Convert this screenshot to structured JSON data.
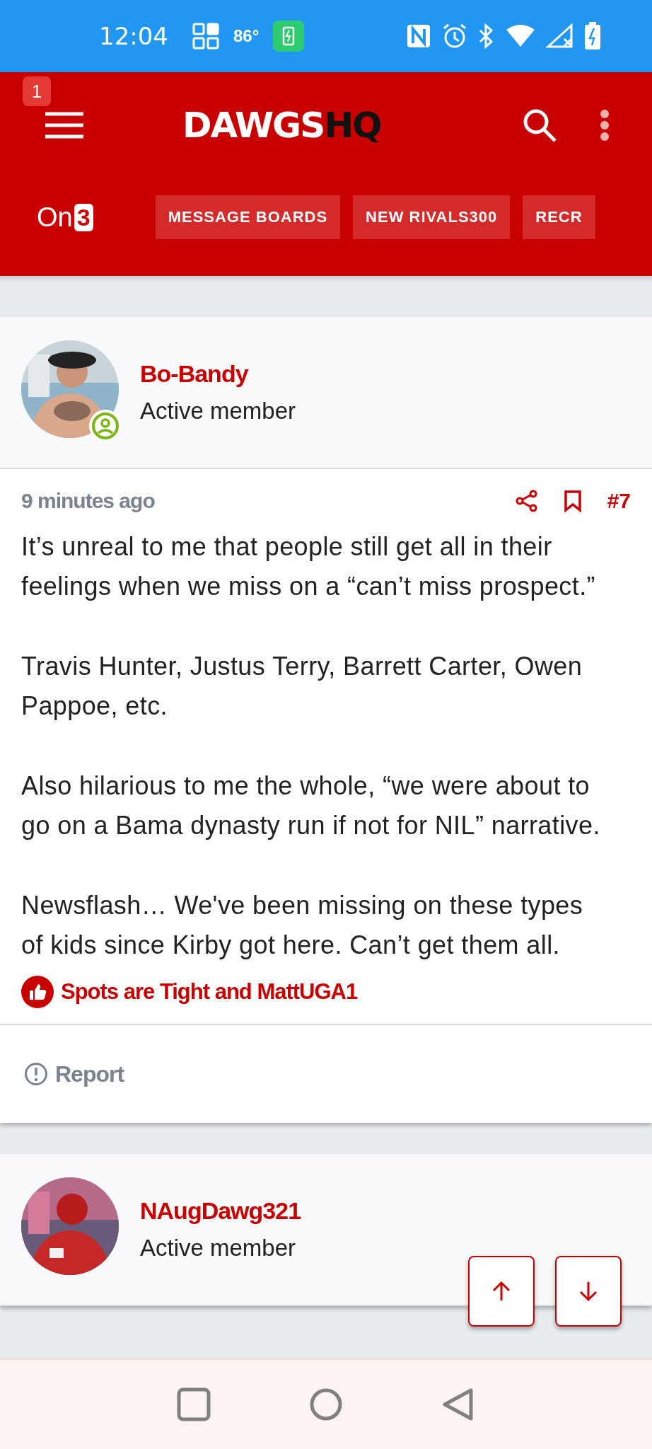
{
  "status_bar": {
    "time": "12:04",
    "temperature": "86°"
  },
  "header": {
    "notification_badge": "1",
    "logo": {
      "main": "DAWGS",
      "accent": "HQ"
    }
  },
  "nav": {
    "brand": {
      "text": "On",
      "digit": "3"
    },
    "links": [
      {
        "label": "MESSAGE BOARDS"
      },
      {
        "label": "NEW RIVALS300"
      },
      {
        "label": "RECR"
      }
    ]
  },
  "posts": [
    {
      "author": "Bo-Bandy",
      "role": "Active member",
      "online": true,
      "time": "9 minutes ago",
      "number": "#7",
      "paragraphs": [
        "It’s unreal to me that people still get all in their feelings when we miss on a “can’t miss prospect.”",
        "Travis Hunter, Justus Terry, Barrett Carter, Owen Pappoe, etc.",
        "Also hilarious to me the whole, “we were about to go on a Bama dynasty run if not for NIL” narrative.",
        "Newsflash… We've been missing on these types of kids since Kirby got here. Can’t get them all."
      ],
      "reactions": "Spots are Tight and MattUGA1",
      "report": "Report"
    },
    {
      "author": "NAugDawg321",
      "role": "Active member"
    }
  ]
}
